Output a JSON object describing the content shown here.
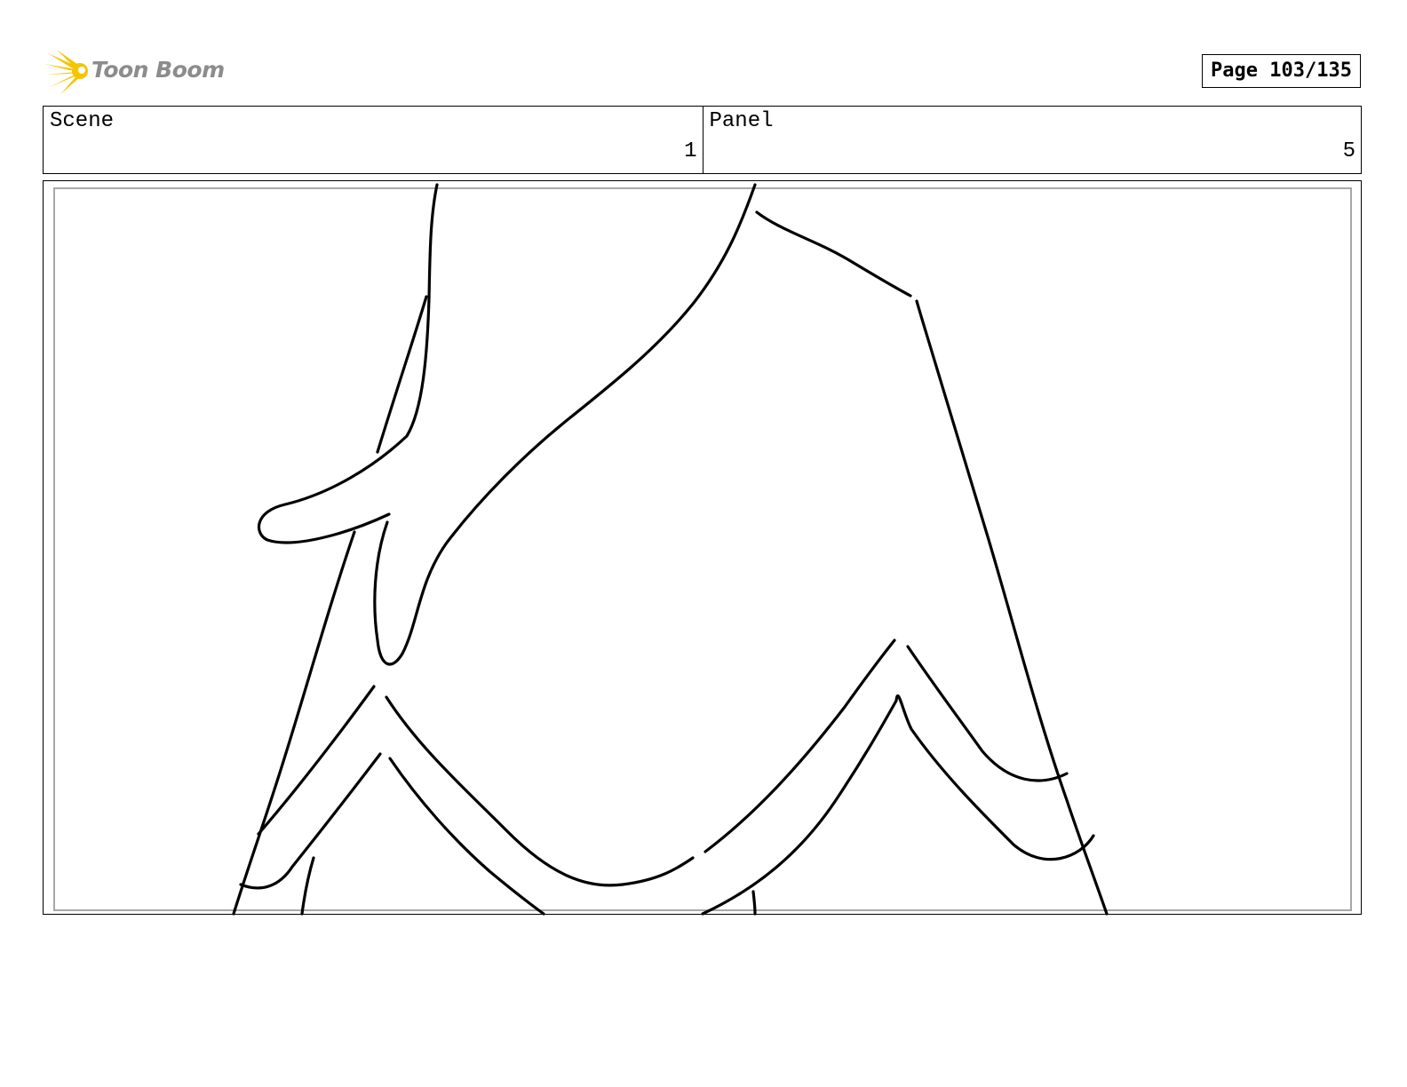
{
  "header": {
    "logo_text": "Toon Boom",
    "page_label": "Page 103/135"
  },
  "info": {
    "scene_label": "Scene",
    "scene_value": "1",
    "panel_label": "Panel",
    "panel_value": "5"
  },
  "colors": {
    "logo_star": "#f6c400",
    "logo_text": "#8c8c8c",
    "sketch_stroke": "#000000",
    "panel_border": "#a8a8a8"
  }
}
